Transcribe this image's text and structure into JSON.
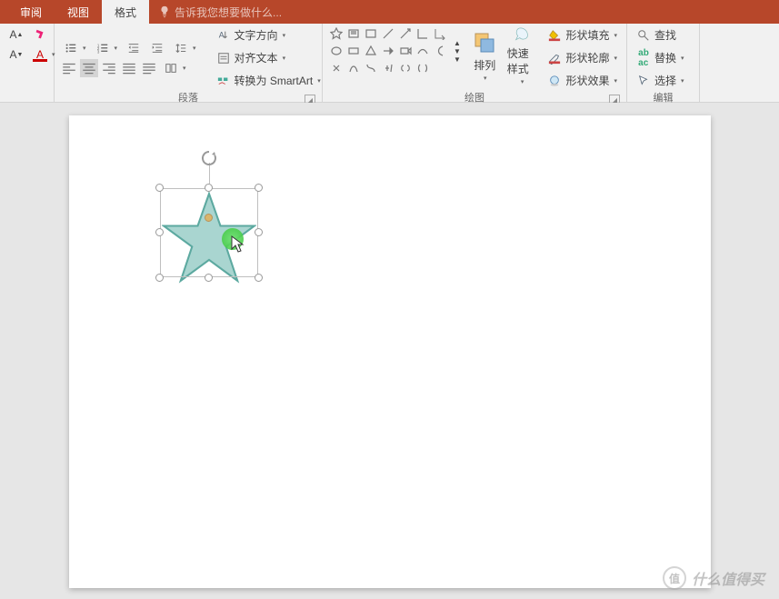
{
  "tabs": {
    "review": "审阅",
    "view": "视图",
    "format": "格式"
  },
  "tell_me": "告诉我您想要做什么...",
  "paragraph": {
    "label": "段落",
    "text_direction": "文字方向",
    "align_text": "对齐文本",
    "smartart": "转换为 SmartArt"
  },
  "drawing": {
    "label": "绘图",
    "arrange": "排列",
    "quick_styles": "快速样式",
    "fill": "形状填充",
    "outline": "形状轮廓",
    "effects": "形状效果"
  },
  "editing": {
    "label": "编辑",
    "find": "查找",
    "replace": "替换",
    "select": "选择"
  },
  "watermark": "什么值得买",
  "shape": {
    "type": "star5",
    "fill": "#a9d5d0",
    "stroke": "#5ca9a0",
    "selected": true
  }
}
